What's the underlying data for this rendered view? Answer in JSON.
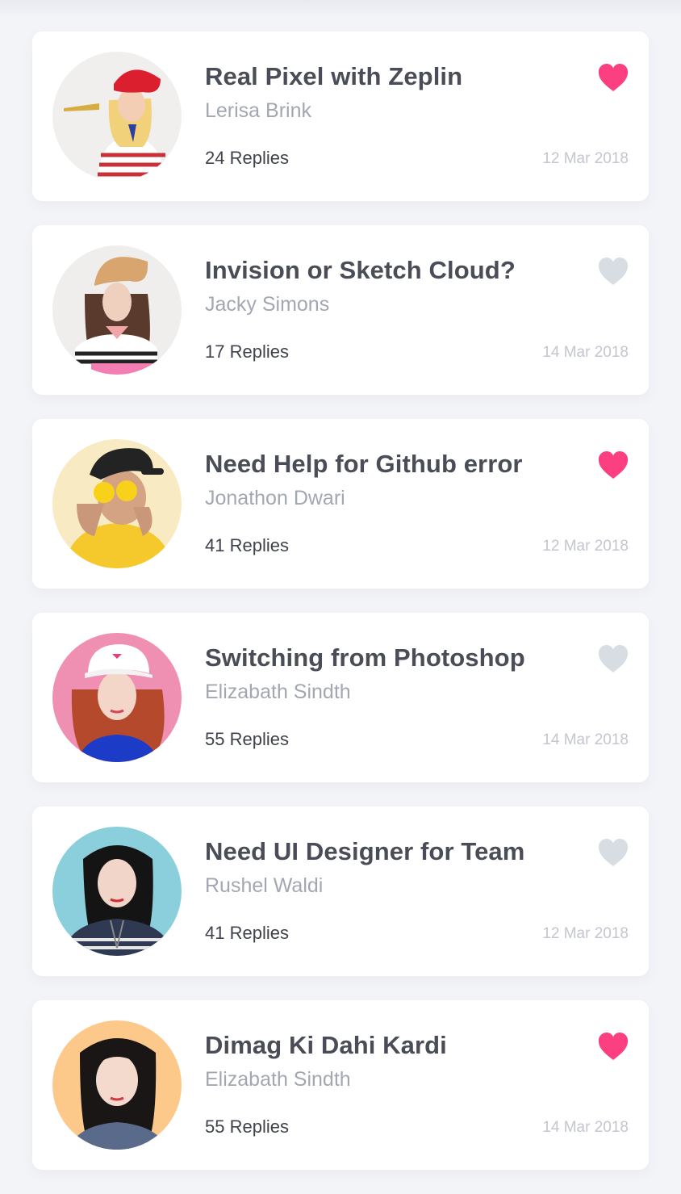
{
  "colors": {
    "liked": "#fc3f80",
    "unliked": "#d8dde3",
    "title": "#4a4d57",
    "author": "#a3a7b3",
    "replies": "#3f424b",
    "date": "#c3c6ce",
    "background": "#f3f4f8"
  },
  "posts": [
    {
      "title": "Real Pixel with Zeplin",
      "author": "Lerisa Brink",
      "replies": "24 Replies",
      "date": "12 Mar 2018",
      "liked": true,
      "avatar_bg": "#f0efed",
      "avatar_icon": "avatar-photo-icon"
    },
    {
      "title": "Invision or Sketch Cloud?",
      "author": "Jacky Simons",
      "replies": "17 Replies",
      "date": "14 Mar 2018",
      "liked": false,
      "avatar_bg": "#efeeed",
      "avatar_icon": "avatar-photo-icon"
    },
    {
      "title": "Need Help for Github error",
      "author": "Jonathon Dwari",
      "replies": "41 Replies",
      "date": "12 Mar 2018",
      "liked": true,
      "avatar_bg": "#f8eac2",
      "avatar_icon": "avatar-photo-icon"
    },
    {
      "title": "Switching from Photoshop",
      "author": "Elizabath Sindth",
      "replies": "55 Replies",
      "date": "14 Mar 2018",
      "liked": false,
      "avatar_bg": "#ef8fb2",
      "avatar_icon": "avatar-photo-icon"
    },
    {
      "title": "Need UI Designer for Team",
      "author": "Rushel Waldi",
      "replies": "41 Replies",
      "date": "12 Mar 2018",
      "liked": false,
      "avatar_bg": "#8ccfdc",
      "avatar_icon": "avatar-photo-icon"
    },
    {
      "title": "Dimag Ki Dahi Kardi",
      "author": "Elizabath Sindth",
      "replies": "55 Replies",
      "date": "14 Mar 2018",
      "liked": true,
      "avatar_bg": "#fcc98a",
      "avatar_icon": "avatar-photo-icon"
    }
  ]
}
